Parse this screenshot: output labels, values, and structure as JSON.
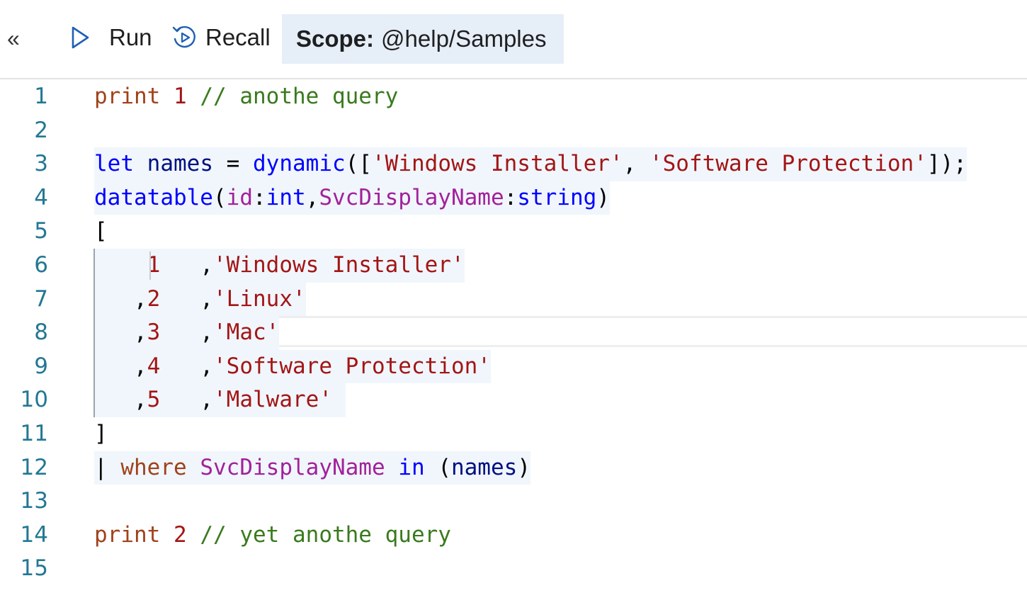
{
  "toolbar": {
    "collapse_label": "«",
    "run_label": "Run",
    "recall_label": "Recall",
    "scope_prefix": "Scope:",
    "scope_value": "@help/Samples"
  },
  "editor": {
    "line_numbers": [
      "1",
      "2",
      "3",
      "4",
      "5",
      "6",
      "7",
      "8",
      "9",
      "10",
      "11",
      "12",
      "13",
      "14",
      "15"
    ],
    "lines": [
      "print 1 // anothe query",
      "",
      "let names = dynamic(['Windows Installer', 'Software Protection']);",
      "datatable(id:int,SvcDisplayName:string)",
      "[",
      "    1   ,'Windows Installer'",
      "   ,2   ,'Linux'",
      "   ,3   ,'Mac'",
      "   ,4   ,'Software Protection'",
      "   ,5   ,'Malware'",
      "]",
      "| where SvcDisplayName in (names)",
      "",
      "print 2 // yet anothe query",
      ""
    ],
    "current_line": 8
  },
  "colors": {
    "keyword": "#0000ff",
    "string": "#a31515",
    "comment": "#3a7a1e",
    "line_number": "#237893",
    "selection_highlight": "#f0f6fc",
    "scope_background": "#e6eef8"
  }
}
